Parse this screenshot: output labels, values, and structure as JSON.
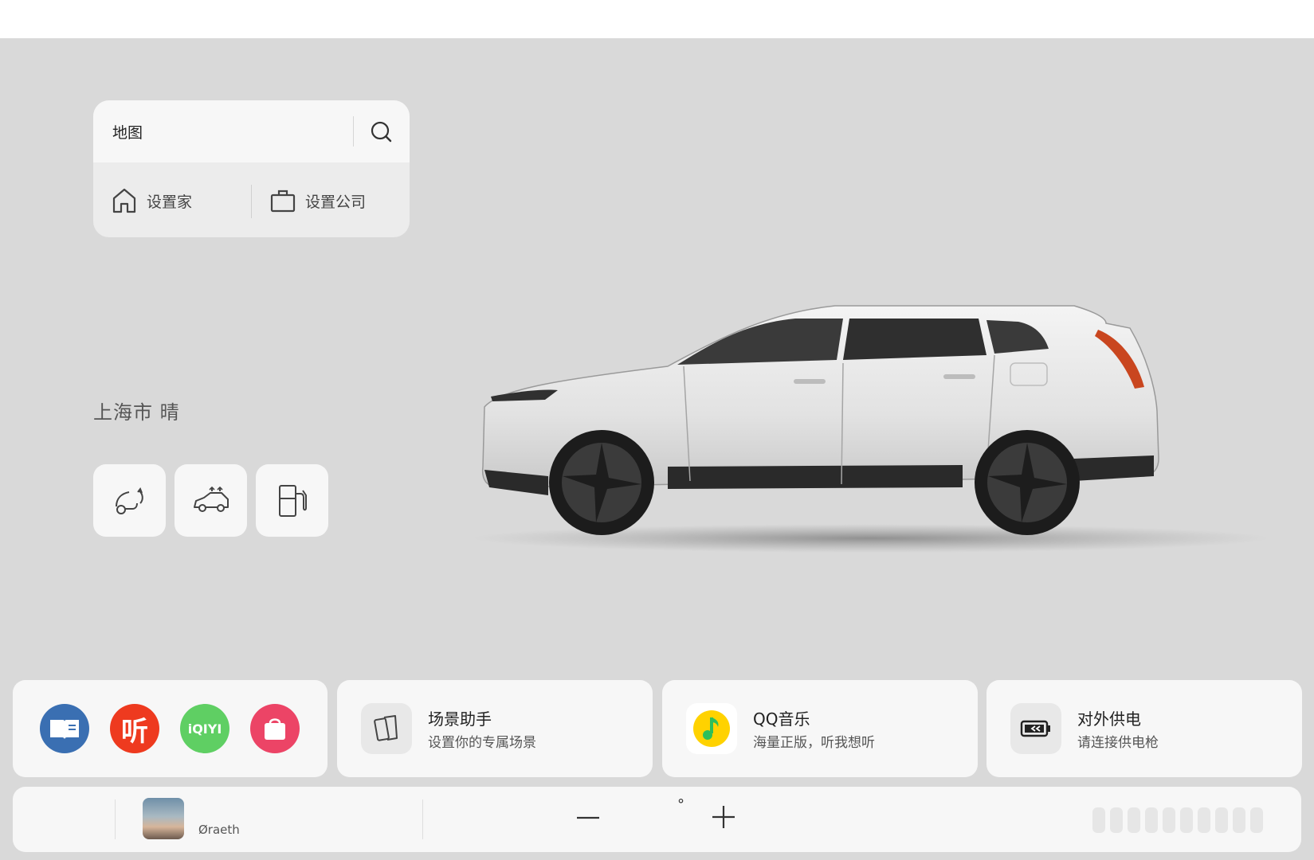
{
  "map": {
    "title": "地图",
    "home_label": "设置家",
    "work_label": "设置公司"
  },
  "weather": "上海市 晴",
  "quick_controls": [
    {
      "icon": "hatch-toggle-icon"
    },
    {
      "icon": "car-trunk-open-icon"
    },
    {
      "icon": "fuel-pump-icon"
    }
  ],
  "apps": [
    {
      "icon": "book-reader-app-icon",
      "color": "#3a6fb2"
    },
    {
      "icon": "ting-audio-app-icon",
      "label": "听",
      "color": "#ee3a1f"
    },
    {
      "icon": "iqiyi-app-icon",
      "label": "iQIYI",
      "color": "#5fcf63"
    },
    {
      "icon": "shopping-bag-app-icon",
      "color": "#ec4466"
    }
  ],
  "cards": {
    "scene": {
      "title": "场景助手",
      "subtitle": "设置你的专属场景",
      "icon": "scene-cards-icon"
    },
    "music": {
      "title": "QQ音乐",
      "subtitle": "海量正版，听我想听",
      "icon": "qq-music-icon"
    },
    "power": {
      "title": "对外供电",
      "subtitle": "请连接供电枪",
      "icon": "battery-discharge-icon"
    }
  },
  "media": {
    "artist": "Øraeth"
  },
  "climate": {
    "degree_symbol": "°"
  },
  "colors": {
    "background": "#d9d9d9",
    "card": "#f7f7f7",
    "qq_yellow": "#ffd200",
    "qq_green": "#2dbf5a"
  }
}
